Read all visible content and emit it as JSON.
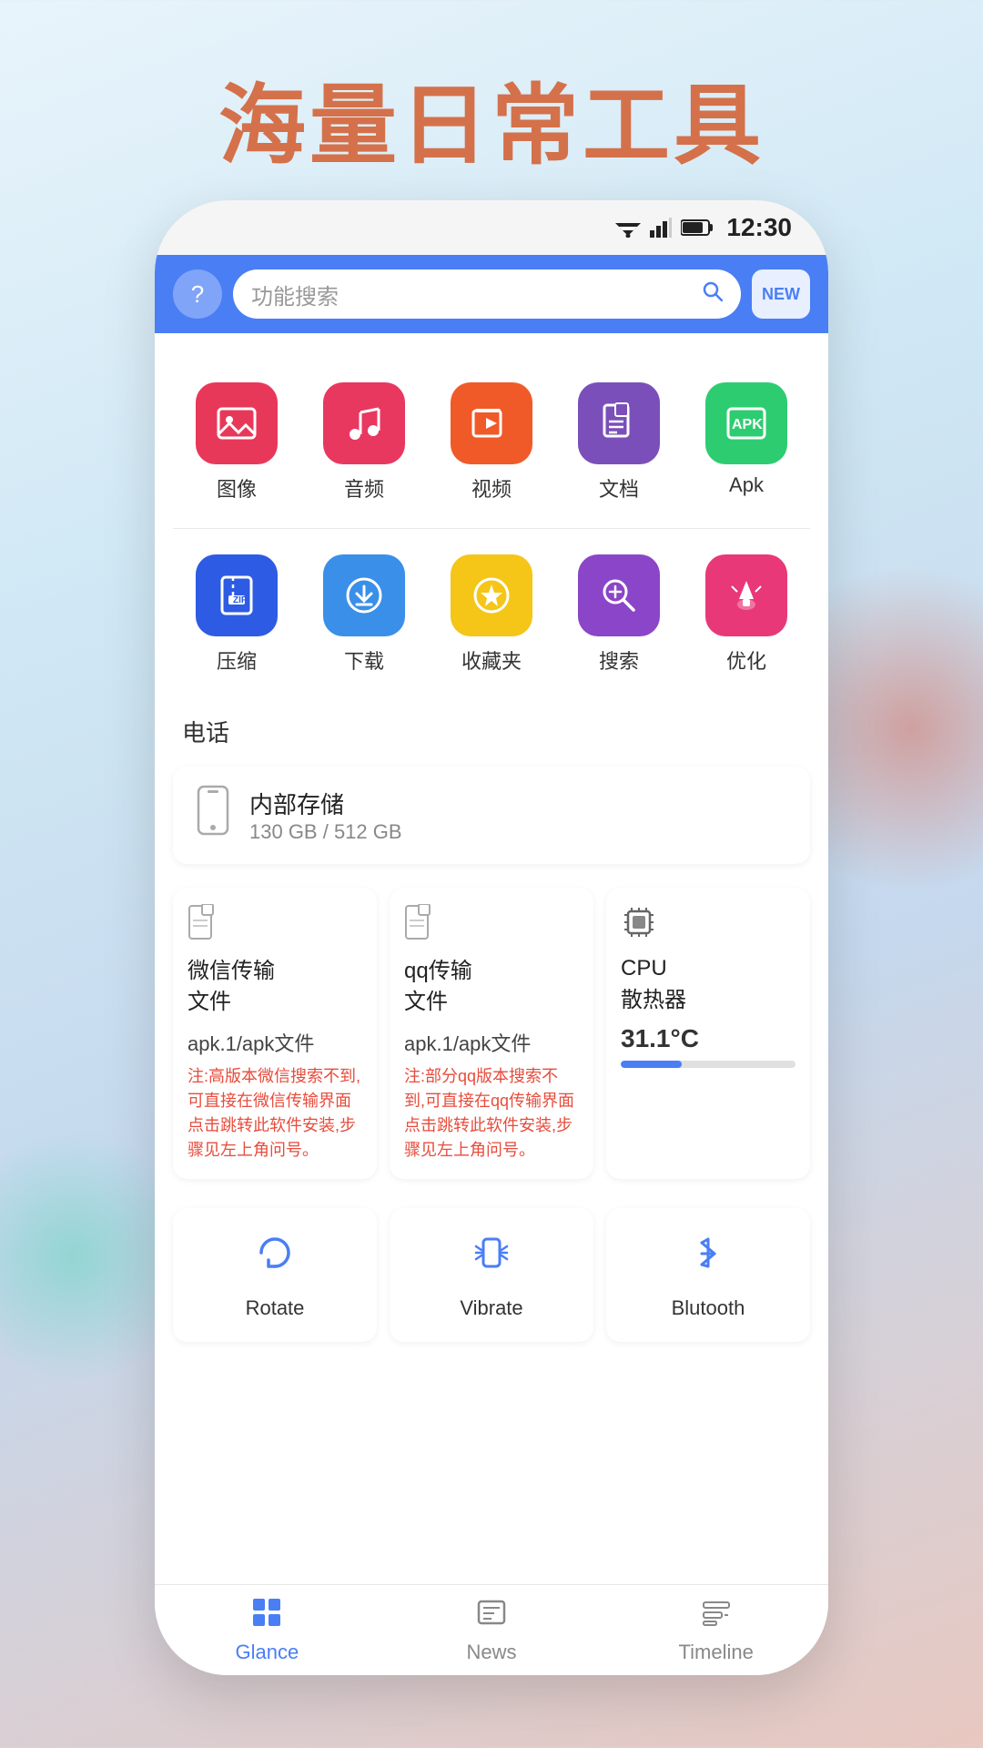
{
  "page": {
    "title": "海量日常工具",
    "background_color": "#d4714a"
  },
  "status_bar": {
    "time": "12:30"
  },
  "top_bar": {
    "search_placeholder": "功能搜索",
    "new_badge": "NEW"
  },
  "icon_grid": {
    "row1": [
      {
        "label": "图像",
        "icon": "🖼️",
        "bg": "bg-pink"
      },
      {
        "label": "音频",
        "icon": "🎵",
        "bg": "bg-red-music"
      },
      {
        "label": "视频",
        "icon": "▶️",
        "bg": "bg-orange-video"
      },
      {
        "label": "文档",
        "icon": "📄",
        "bg": "bg-purple-doc"
      },
      {
        "label": "Apk",
        "icon": "📦",
        "bg": "bg-green-apk"
      }
    ],
    "row2": [
      {
        "label": "压缩",
        "icon": "🗜️",
        "bg": "bg-blue-zip"
      },
      {
        "label": "下载",
        "icon": "⬇️",
        "bg": "bg-blue-dl"
      },
      {
        "label": "收藏夹",
        "icon": "⭐",
        "bg": "bg-yellow-fav"
      },
      {
        "label": "搜索",
        "icon": "🔍",
        "bg": "bg-purple-search"
      },
      {
        "label": "优化",
        "icon": "🚀",
        "bg": "bg-pink-opt"
      }
    ]
  },
  "phone_section": {
    "label": "电话",
    "storage": {
      "name": "内部存储",
      "used": "130 GB",
      "total": "512 GB",
      "display": "130 GB / 512 GB"
    }
  },
  "quick_cards": [
    {
      "title": "微信传输文件",
      "icon": "📁",
      "file_type": "apk.1/apk文件",
      "note": "注:高版本微信搜索不到,可直接在微信传输界面点击跳转此软件安装,步骤见左上角问号。"
    },
    {
      "title": "qq传输文件",
      "icon": "📁",
      "file_type": "apk.1/apk文件",
      "note": "注:部分qq版本搜索不到,可直接在qq传输界面点击跳转此软件安装,步骤见左上角问号。"
    }
  ],
  "cpu_card": {
    "title": "CPU散热器",
    "temp": "31.1°C",
    "bar_percent": 35
  },
  "tools": [
    {
      "label": "Rotate",
      "icon": "↻"
    },
    {
      "label": "Vibrate",
      "icon": "📳"
    },
    {
      "label": "Blutooth",
      "icon": "⚡"
    }
  ],
  "bottom_nav": [
    {
      "label": "Glance",
      "icon": "grid",
      "active": true
    },
    {
      "label": "News",
      "icon": "news",
      "active": false
    },
    {
      "label": "Timeline",
      "icon": "timeline",
      "active": false
    }
  ]
}
